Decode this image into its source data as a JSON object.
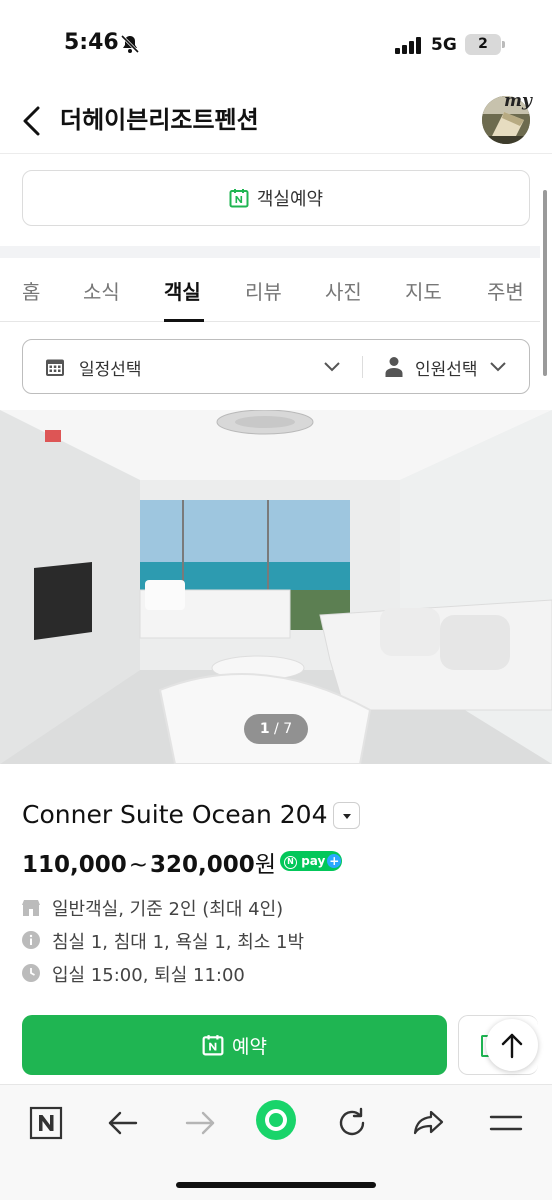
{
  "status_bar": {
    "time": "5:46",
    "network": "5G",
    "battery": "2"
  },
  "header": {
    "title": "더헤이븐리조트펜션",
    "profile_label": "my"
  },
  "reserve_top": {
    "label": "객실예약"
  },
  "tabs": [
    {
      "label": "홈",
      "active": false
    },
    {
      "label": "소식",
      "active": false
    },
    {
      "label": "객실",
      "active": true
    },
    {
      "label": "리뷰",
      "active": false
    },
    {
      "label": "사진",
      "active": false
    },
    {
      "label": "지도",
      "active": false
    },
    {
      "label": "주변",
      "active": false
    }
  ],
  "filter": {
    "date_label": "일정선택",
    "people_label": "인원선택"
  },
  "photo": {
    "current": "1",
    "separator": " / ",
    "total": "7"
  },
  "room": {
    "name": "Conner Suite Ocean 204",
    "price_min": "110,000",
    "price_sep": "~",
    "price_max": "320,000",
    "price_unit": "원",
    "npay_label": "pay",
    "info": [
      {
        "icon": "building-icon",
        "text": "일반객실, 기준 2인 (최대 4인)"
      },
      {
        "icon": "info-icon",
        "text": "침실 1, 침대 1, 욕실 1, 최소 1박"
      },
      {
        "icon": "clock-icon",
        "text": "입실 15:00, 퇴실 11:00"
      }
    ]
  },
  "actions": {
    "book_label": "예약"
  },
  "colors": {
    "brand_green": "#1fb552",
    "npay_green": "#03c75a",
    "text": "#111111"
  }
}
